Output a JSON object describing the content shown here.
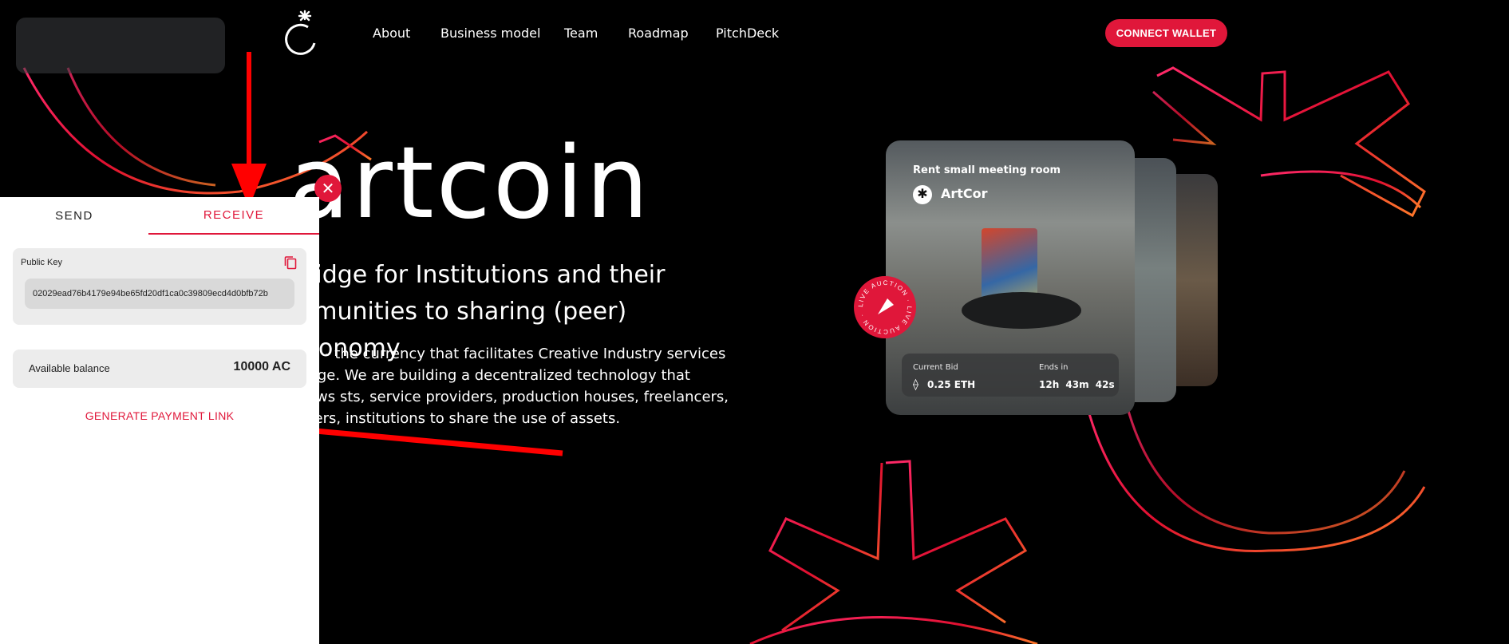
{
  "header": {
    "logo_icon": "artcoin-logo-icon",
    "nav": [
      {
        "label": "About"
      },
      {
        "label": "Business model"
      },
      {
        "label": "Team"
      },
      {
        "label": "Roadmap"
      },
      {
        "label": "PitchDeck"
      }
    ],
    "connect_label": "CONNECT WALLET"
  },
  "hero": {
    "title": "artcoin",
    "subtitle": "bridge for Institutions and their mmunities to sharing (peer) economy",
    "description": "coin - the currency that facilitates Creative Industry services hange. We are building a decentralized technology that allows sts, service providers, production houses, freelancers, nteers, institutions to share the use of assets."
  },
  "card": {
    "title": "Rent small meeting room",
    "owner": "ArtCor",
    "badge_text": "LIVE AUCTION · LIVE AUCTION ·",
    "current_bid_label": "Current Bid",
    "current_bid_value": "0.25 ETH",
    "ends_label": "Ends in",
    "ends_value": "12h 43m 42s"
  },
  "wallet": {
    "close_icon": "close-icon",
    "tabs": {
      "send": "SEND",
      "receive": "RECEIVE"
    },
    "active_tab": "receive",
    "public_key_label": "Public Key",
    "public_key_value": "02029ead76b4179e94be65fd20df1ca0c39809ecd4d0bfb72b",
    "balance_label": "Available balance",
    "balance_value": "10000 AC",
    "generate_link": "GENERATE PAYMENT LINK"
  },
  "colors": {
    "accent": "#e0173a",
    "background": "#000000",
    "panel": "#ffffff"
  }
}
